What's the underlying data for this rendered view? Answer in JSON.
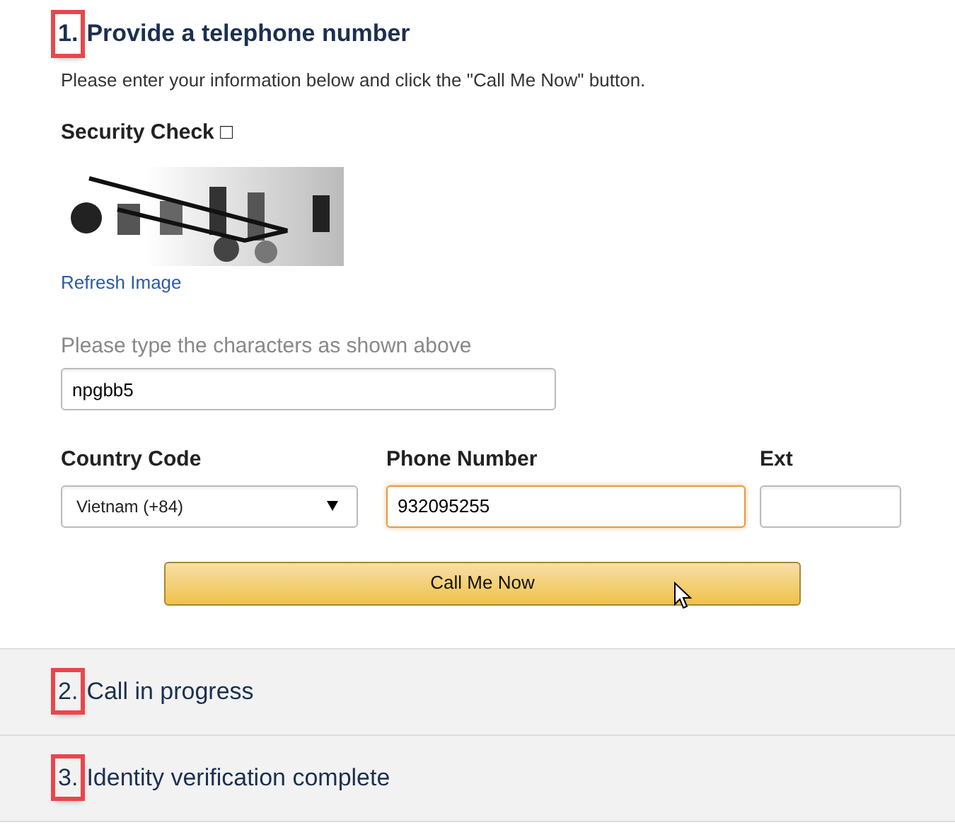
{
  "steps": [
    {
      "number": "1.",
      "title": "Provide a telephone number",
      "expanded": true,
      "highlighted": true
    },
    {
      "number": "2.",
      "title": "Call in progress",
      "expanded": false,
      "highlighted": true
    },
    {
      "number": "3.",
      "title": "Identity verification complete",
      "expanded": false,
      "highlighted": true
    }
  ],
  "intro": "Please enter your information below and click the \"Call Me Now\" button.",
  "security_check": {
    "label": "Security Check □",
    "refresh_link": "Refresh Image",
    "prompt": "Please type the characters as shown above",
    "value": "npgbb5"
  },
  "fields": [
    {
      "label": "Country Code",
      "kind": "select",
      "value": "Vietnam (+84)",
      "focused": false
    },
    {
      "label": "Phone Number",
      "kind": "text",
      "value": "932095255",
      "focused": true
    },
    {
      "label": "Ext",
      "kind": "text",
      "focused": false
    }
  ],
  "submit_button": "Call Me Now"
}
